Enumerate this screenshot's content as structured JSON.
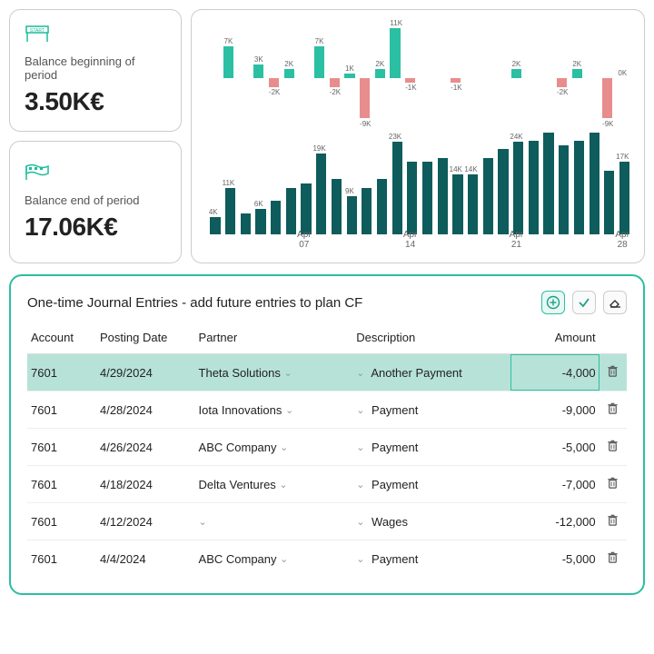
{
  "kpi": {
    "begin": {
      "label": "Balance beginning of period",
      "value": "3.50K€"
    },
    "end": {
      "label": "Balance end of period",
      "value": "17.06K€"
    }
  },
  "chart_data": {
    "type": "bar",
    "xlabel": "",
    "ylabel": "",
    "x_ticks": [
      "Apr 07",
      "Apr 14",
      "Apr 21",
      "Apr 28"
    ],
    "series": [
      {
        "name": "daily_delta_k",
        "values": [
          0,
          7,
          0,
          3,
          -2,
          2,
          0,
          7,
          -2,
          1,
          -9,
          2,
          11,
          -1,
          0,
          0,
          -1,
          0,
          0,
          0,
          2,
          0,
          0,
          -2,
          2,
          0,
          -9,
          0
        ]
      },
      {
        "name": "balance_k",
        "values": [
          4,
          11,
          5,
          6,
          8,
          11,
          12,
          19,
          13,
          9,
          11,
          13,
          23,
          17,
          17,
          18,
          14,
          14,
          18,
          20,
          24,
          22,
          24,
          21,
          22,
          24,
          15,
          17
        ]
      }
    ],
    "delta_labels": [
      "",
      "7K",
      "",
      "3K",
      "-2K",
      "2K",
      "",
      "7K",
      "-2K",
      "1K",
      "-9K",
      "2K",
      "11K",
      "-1K",
      "",
      "",
      "-1K",
      "",
      "",
      "",
      "2K",
      "",
      "",
      "-2K",
      "2K",
      "",
      "-9K",
      "0K"
    ],
    "balance_labels": [
      "4K",
      "11K",
      "",
      "6K",
      "",
      "",
      "",
      "19K",
      "",
      "9K",
      "",
      "",
      "23K",
      "",
      "",
      "",
      "14K",
      "14K",
      "",
      "",
      "24K",
      "",
      "",
      "",
      "",
      "",
      "",
      "17K"
    ]
  },
  "journal": {
    "title": "One-time Journal Entries - add future entries to plan CF",
    "columns": {
      "account": "Account",
      "date": "Posting Date",
      "partner": "Partner",
      "desc": "Description",
      "amount": "Amount"
    },
    "rows": [
      {
        "account": "7601",
        "date": "4/29/2024",
        "partner": "Theta Solutions",
        "desc": "Another Payment",
        "amount": "-4,000",
        "selected": true
      },
      {
        "account": "7601",
        "date": "4/28/2024",
        "partner": "Iota Innovations",
        "desc": "Payment",
        "amount": "-9,000"
      },
      {
        "account": "7601",
        "date": "4/26/2024",
        "partner": "ABC Company",
        "desc": "Payment",
        "amount": "-5,000"
      },
      {
        "account": "7601",
        "date": "4/18/2024",
        "partner": "Delta Ventures",
        "desc": "Payment",
        "amount": "-7,000"
      },
      {
        "account": "7601",
        "date": "4/12/2024",
        "partner": "",
        "desc": "Wages",
        "amount": "-12,000"
      },
      {
        "account": "7601",
        "date": "4/4/2024",
        "partner": "ABC Company",
        "desc": "Payment",
        "amount": "-5,000"
      }
    ]
  }
}
